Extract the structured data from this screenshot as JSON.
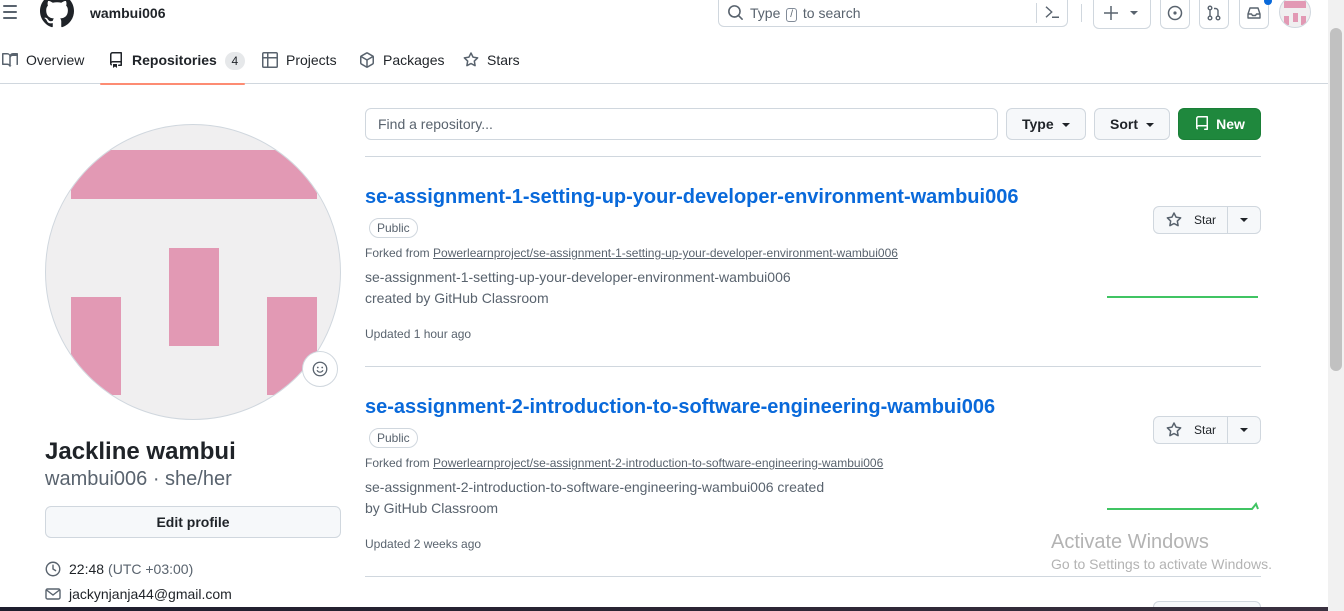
{
  "header": {
    "username": "wambui006",
    "search_prefix": "Type",
    "search_key": "/",
    "search_suffix": "to search"
  },
  "tabs": [
    {
      "label": "Overview"
    },
    {
      "label": "Repositories",
      "count": "4"
    },
    {
      "label": "Projects"
    },
    {
      "label": "Packages"
    },
    {
      "label": "Stars"
    }
  ],
  "profile": {
    "full_name": "Jackline wambui",
    "handle": "wambui006 · she/her",
    "edit_label": "Edit profile",
    "local_time": "22:48",
    "timezone": "(UTC +03:00)",
    "email": "jackynjanja44@gmail.com"
  },
  "filters": {
    "search_placeholder": "Find a repository...",
    "type_label": "Type",
    "sort_label": "Sort",
    "new_label": "New"
  },
  "repos": [
    {
      "name": "se-assignment-1-setting-up-your-developer-environment-wambui006",
      "visibility": "Public",
      "forked_prefix": "Forked from",
      "forked_from": "Powerlearnproject/se-assignment-1-setting-up-your-developer-environment-wambui006",
      "description_line1": "se-assignment-1-setting-up-your-developer-environment-wambui006",
      "description_line2": "created by GitHub Classroom",
      "updated": "Updated 1 hour ago",
      "star_label": "Star"
    },
    {
      "name": "se-assignment-2-introduction-to-software-engineering-wambui006",
      "visibility": "Public",
      "forked_prefix": "Forked from",
      "forked_from": "Powerlearnproject/se-assignment-2-introduction-to-software-engineering-wambui006",
      "description_line1": "se-assignment-2-introduction-to-software-engineering-wambui006 created",
      "description_line2": "by GitHub Classroom",
      "updated": "Updated 2 weeks ago",
      "star_label": "Star"
    }
  ],
  "watermark": {
    "title": "Activate Windows",
    "subtitle": "Go to Settings to activate Windows."
  },
  "colors": {
    "link": "#0969da",
    "primary_button": "#1f883d",
    "active_tab_underline": "#fd8c73",
    "avatar_pink": "#e299b4",
    "sparkline": "#40c463"
  },
  "icons": [
    "menu-icon",
    "github-logo-icon",
    "search-icon",
    "command-palette-icon",
    "plus-icon",
    "issues-icon",
    "pull-requests-icon",
    "inbox-icon",
    "book-icon",
    "repo-icon",
    "table-icon",
    "package-icon",
    "star-icon",
    "smiley-icon",
    "clock-icon",
    "mail-icon"
  ]
}
